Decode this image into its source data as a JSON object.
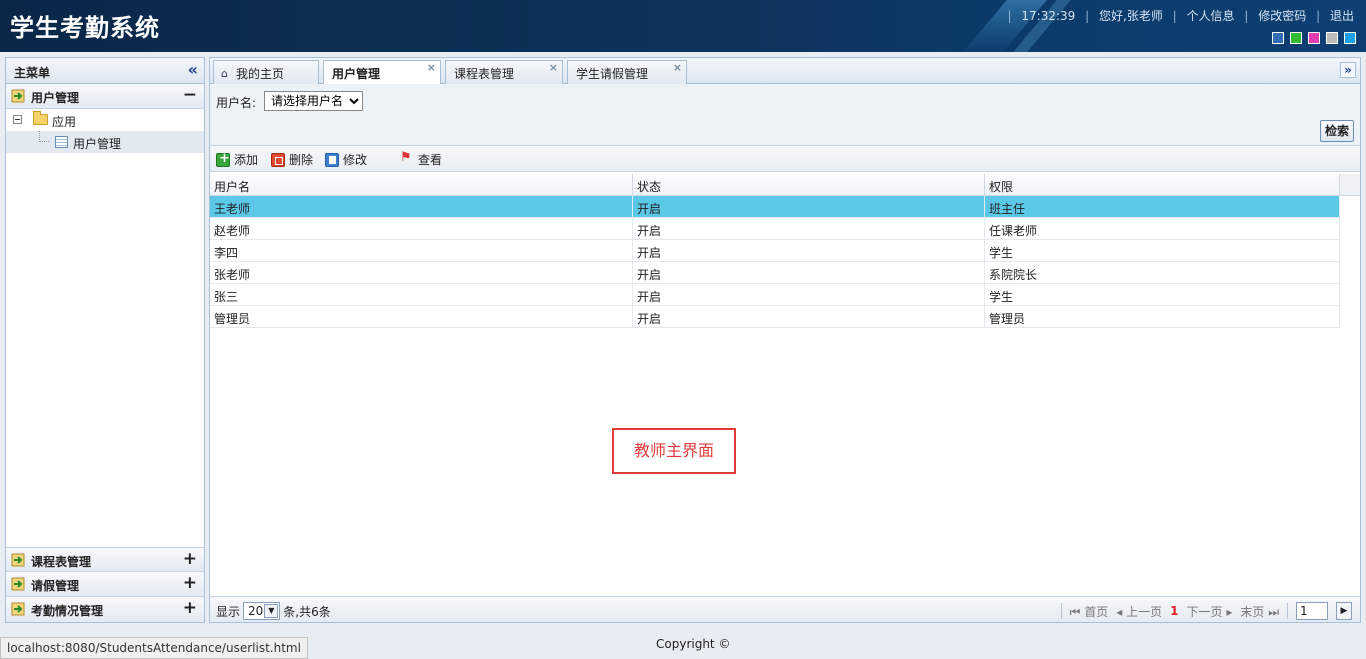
{
  "header": {
    "title": "学生考勤系统",
    "time": "17:32:39",
    "greeting": "您好,张老师",
    "profile": "个人信息",
    "change_password": "修改密码",
    "logout": "退出",
    "theme_colors": [
      "#2f6db3",
      "#33bb33",
      "#e03bb0",
      "#bbbbbb",
      "#1aa3e0"
    ]
  },
  "sidebar": {
    "title": "主菜单",
    "sections": [
      {
        "label": "用户管理",
        "toggle": "−"
      },
      {
        "label": "课程表管理",
        "toggle": "+"
      },
      {
        "label": "请假管理",
        "toggle": "+"
      },
      {
        "label": "考勤情况管理",
        "toggle": "+"
      }
    ],
    "tree": {
      "folder": "应用",
      "leaf": "用户管理"
    }
  },
  "tabs": [
    {
      "label": "我的主页",
      "closable": false
    },
    {
      "label": "用户管理",
      "closable": true,
      "active": true
    },
    {
      "label": "课程表管理",
      "closable": true
    },
    {
      "label": "学生请假管理",
      "closable": true
    }
  ],
  "filter": {
    "label": "用户名:",
    "select_value": "请选择用户名",
    "search_button": "检索"
  },
  "toolbar": {
    "add": "添加",
    "delete": "删除",
    "edit": "修改",
    "view": "查看"
  },
  "grid": {
    "columns": [
      "用户名",
      "状态",
      "权限"
    ],
    "rows": [
      [
        "王老师",
        "开启",
        "班主任"
      ],
      [
        "赵老师",
        "开启",
        "任课老师"
      ],
      [
        "李四",
        "开启",
        "学生"
      ],
      [
        "张老师",
        "开启",
        "系院院长"
      ],
      [
        "张三",
        "开启",
        "学生"
      ],
      [
        "管理员",
        "开启",
        "管理员"
      ]
    ]
  },
  "annotation": "教师主界面",
  "pager": {
    "show_label": "显示",
    "page_size": "20",
    "summary": "条,共6条",
    "first": "首页",
    "prev": "上一页",
    "current": "1",
    "next": "下一页",
    "last": "末页",
    "page_input": "1"
  },
  "status_url": "localhost:8080/StudentsAttendance/userlist.html",
  "copyright": "Copyright ©"
}
